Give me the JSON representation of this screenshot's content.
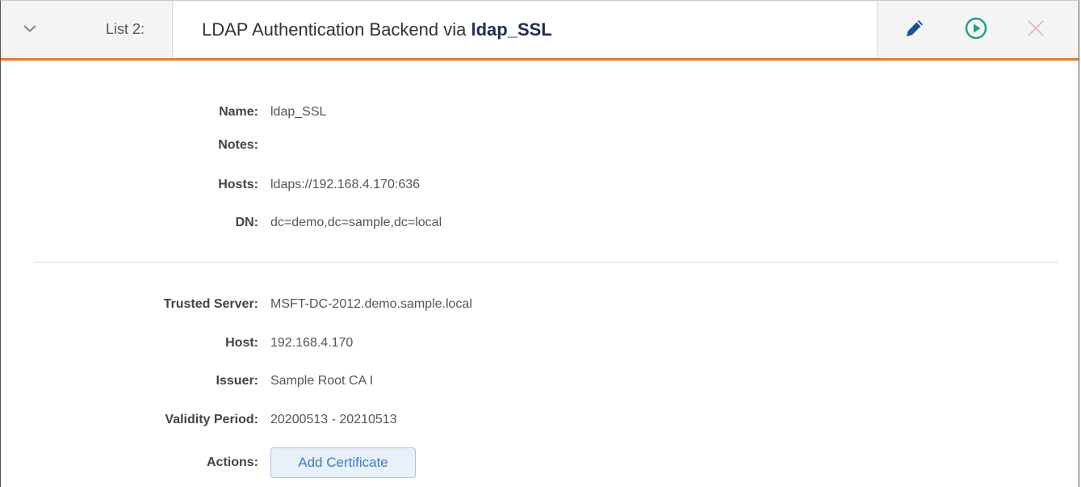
{
  "header": {
    "list_label": "List 2:",
    "title_prefix": "LDAP Authentication Backend via",
    "title_name": "ldap_SSL",
    "accent_color": "#e87722",
    "title_name_color": "#1f2d55",
    "icons": [
      "chevron-down-icon",
      "pencil-icon",
      "play-circle-icon",
      "close-icon"
    ]
  },
  "general": {
    "name_label": "Name:",
    "name_value": "ldap_SSL",
    "notes_label": "Notes:",
    "notes_value": "",
    "hosts_label": "Hosts:",
    "hosts_value": "ldaps://192.168.4.170:636",
    "dn_label": "DN:",
    "dn_value": "dc=demo,dc=sample,dc=local"
  },
  "certificate": {
    "trusted_server_label": "Trusted Server:",
    "trusted_server_value": "MSFT-DC-2012.demo.sample.local",
    "host_label": "Host:",
    "host_value": "192.168.4.170",
    "issuer_label": "Issuer:",
    "issuer_value": "Sample Root CA I",
    "validity_label": "Validity Period:",
    "validity_value": "20200513 - 20210513",
    "actions_label": "Actions:",
    "add_certificate_label": "Add Certificate"
  }
}
